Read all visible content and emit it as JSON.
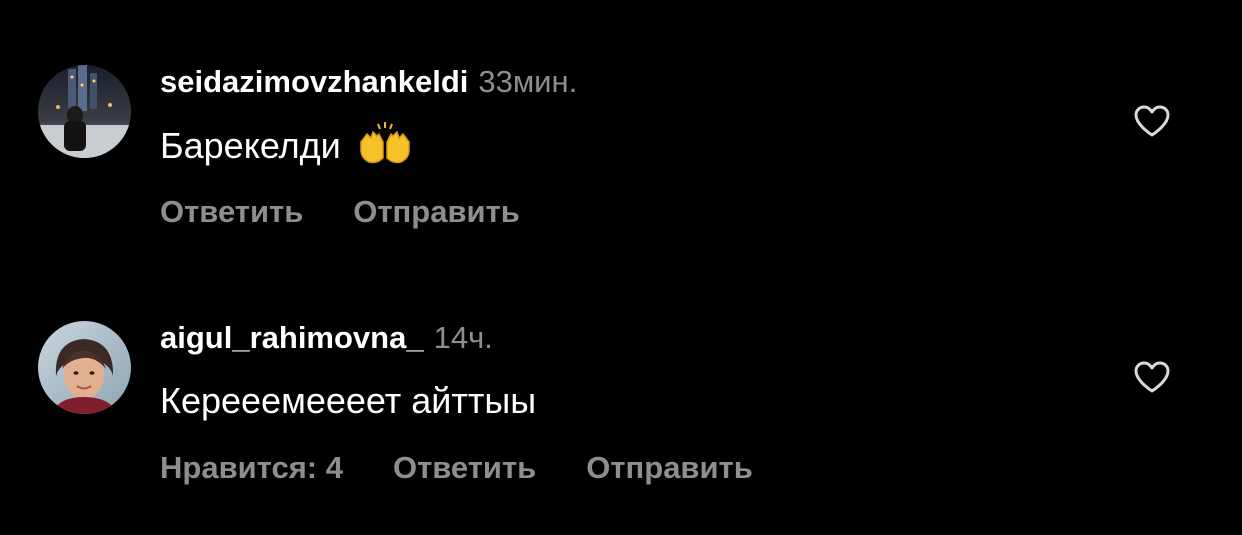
{
  "colors": {
    "background": "#000000",
    "primary_text": "#ffffff",
    "secondary_text": "#8e8e8e"
  },
  "comments": [
    {
      "username": "seidazimovzhankeldi",
      "timestamp": "33мин.",
      "text": "Барекелди",
      "emoji": "raising-hands",
      "like_icon": "heart-outline-icon",
      "actions": {
        "reply": "Ответить",
        "send": "Отправить"
      }
    },
    {
      "username": "aigul_rahimovna_",
      "timestamp": "14ч.",
      "text": "Керееемеееет айттыы",
      "like_icon": "heart-outline-icon",
      "actions": {
        "likes": "Нравится: 4",
        "reply": "Ответить",
        "send": "Отправить"
      }
    }
  ]
}
